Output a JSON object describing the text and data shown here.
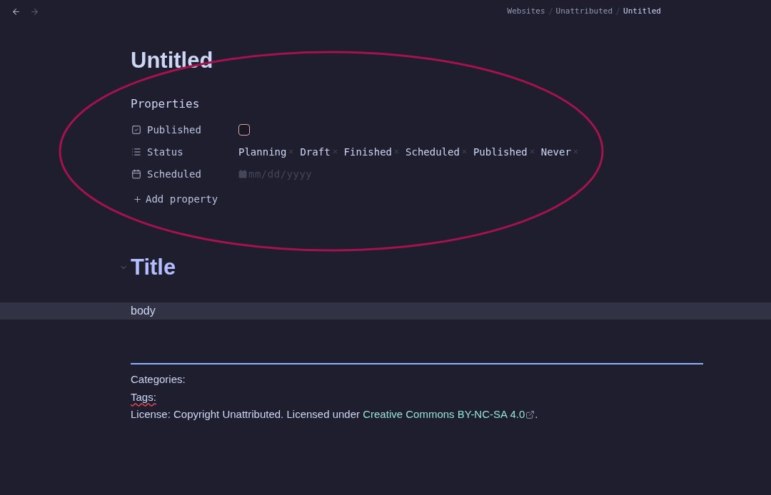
{
  "nav": {
    "back": {
      "disabled": false
    },
    "forward": {
      "disabled": true
    }
  },
  "breadcrumb": [
    {
      "label": "Websites",
      "current": false
    },
    {
      "label": "Unattributed",
      "current": false
    },
    {
      "label": "Untitled",
      "current": true
    }
  ],
  "page_title": "Untitled",
  "properties": {
    "heading": "Properties",
    "items": [
      {
        "kind": "checkbox",
        "label": "Published",
        "checked": false
      },
      {
        "kind": "tags",
        "label": "Status",
        "tags": [
          "Planning",
          "Draft",
          "Finished",
          "Scheduled",
          "Published",
          "Never"
        ]
      },
      {
        "kind": "date",
        "label": "Scheduled",
        "placeholder": "mm/dd/yyyy"
      }
    ],
    "add_button": "Add property"
  },
  "heading": {
    "text": "Title",
    "expanded": true
  },
  "body": {
    "text": "body",
    "active": true
  },
  "footer": {
    "categories": {
      "text": "Categories:",
      "misspelled": false
    },
    "tags": {
      "text": "Tags:",
      "misspelled": true
    },
    "license": {
      "text": "License: Copyright Unattributed. Licensed under",
      "link": "Creative Commons BY-NC-SA 4.0",
      "suffix": "."
    }
  }
}
